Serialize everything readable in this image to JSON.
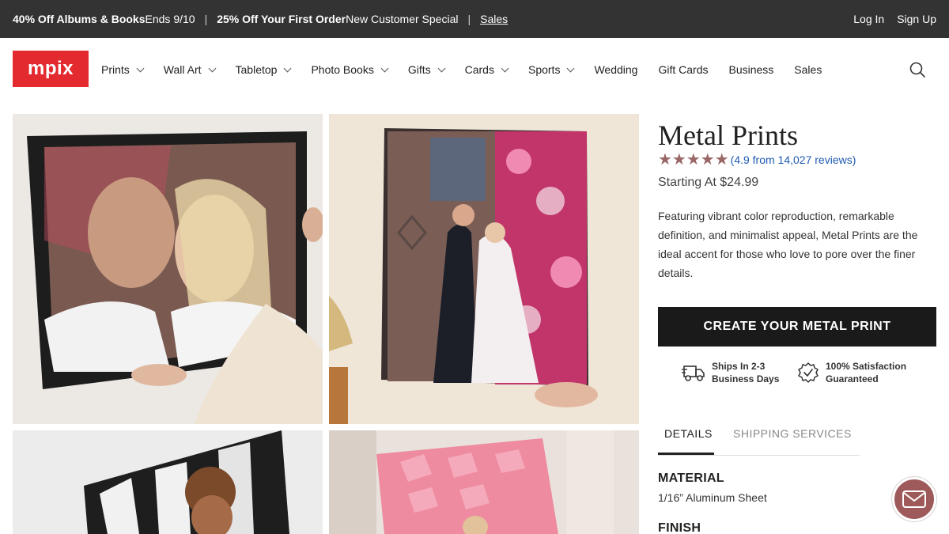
{
  "promo": {
    "offer1_bold": "40% Off Albums & Books",
    "offer1_rest": " Ends 9/10",
    "offer2_bold": "25% Off Your First Order",
    "offer2_rest": " New Customer Special",
    "sales_link": "Sales",
    "separator": "|",
    "login": "Log In",
    "signup": "Sign Up"
  },
  "nav": {
    "logo": "mpix",
    "items": [
      {
        "label": "Prints",
        "dropdown": true
      },
      {
        "label": "Wall Art",
        "dropdown": true
      },
      {
        "label": "Tabletop",
        "dropdown": true
      },
      {
        "label": "Photo Books",
        "dropdown": true
      },
      {
        "label": "Gifts",
        "dropdown": true
      },
      {
        "label": "Cards",
        "dropdown": true
      },
      {
        "label": "Sports",
        "dropdown": true
      },
      {
        "label": "Wedding",
        "dropdown": false
      },
      {
        "label": "Gift Cards",
        "dropdown": false
      },
      {
        "label": "Business",
        "dropdown": false
      },
      {
        "label": "Sales",
        "dropdown": false
      }
    ],
    "search_icon": "search-icon"
  },
  "product": {
    "title": "Metal Prints",
    "stars": "★★★★★",
    "rating_value": 4.9,
    "reviews": "(4.9 from 14,027 reviews)",
    "price": "Starting At $24.99",
    "description": "Featuring vibrant color reproduction, remarkable definition, and minimalist appeal, Metal Prints are the ideal accent for those who love to pore over the finer details.",
    "cta": "CREATE YOUR METAL PRINT",
    "perks": [
      {
        "icon": "truck-icon",
        "line1": "Ships In 2-3",
        "line2": "Business Days"
      },
      {
        "icon": "badge-check-icon",
        "line1": "100% Satisfaction",
        "line2": "Guaranteed"
      }
    ],
    "tabs": [
      {
        "label": "DETAILS",
        "active": true
      },
      {
        "label": "SHIPPING SERVICES",
        "active": false
      }
    ],
    "specs": [
      {
        "heading": "MATERIAL",
        "value": "1/16” Aluminum Sheet"
      },
      {
        "heading": "FINISH",
        "value": ""
      }
    ]
  },
  "colors": {
    "promo_bg": "#333333",
    "logo_red": "#e32a2f",
    "star": "#9a6767",
    "link": "#1e5ab4",
    "cta_bg": "#1a1a1a",
    "chat_bg": "#9e5a5a"
  },
  "gallery": [
    {
      "alt": "couple-in-black-frame-photo"
    },
    {
      "alt": "wedding-couple-graffiti-metal-print"
    },
    {
      "alt": "child-abstract-wall-print"
    },
    {
      "alt": "pink-geometric-metal-print"
    }
  ],
  "chat_icon": "chat-mail-icon"
}
